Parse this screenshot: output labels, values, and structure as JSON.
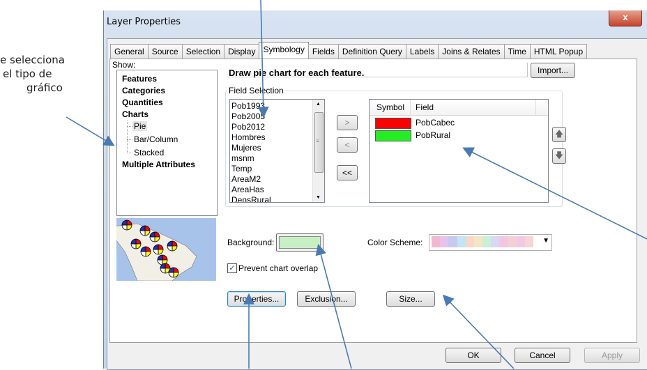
{
  "window": {
    "title": "Layer Properties",
    "close_glyph": "x"
  },
  "tabs": [
    "General",
    "Source",
    "Selection",
    "Display",
    "Symbology",
    "Fields",
    "Definition Query",
    "Labels",
    "Joins & Relates",
    "Time",
    "HTML Popup"
  ],
  "show": {
    "label": "Show:",
    "features": "Features",
    "categories": "Categories",
    "quantities": "Quantities",
    "charts": "Charts",
    "charts_children": [
      "Pie",
      "Bar/Column",
      "Stacked"
    ],
    "multiple": "Multiple Attributes"
  },
  "description": "Draw pie chart for each feature.",
  "import_button": "Import...",
  "field_selection": {
    "label": "Field Selection",
    "available": [
      "Pob1993",
      "Pob2005",
      "Pob2012",
      "Hombres",
      "Mujeres",
      "msnm",
      "Temp",
      "AreaM2",
      "AreaHas",
      "DensRural"
    ],
    "btn_add": ">",
    "btn_remove": "<",
    "btn_remove_all": "<<",
    "col_symbol": "Symbol",
    "col_field": "Field",
    "selected": [
      {
        "color": "#ff0000",
        "field": "PobCabec"
      },
      {
        "color": "#22ee22",
        "field": "PobRural"
      }
    ]
  },
  "background": {
    "label": "Background:",
    "color": "#c6f0c4"
  },
  "color_scheme": {
    "label": "Color Scheme:",
    "swatches": [
      "#f4b8cc",
      "#e7c2ef",
      "#c8c9f3",
      "#bfe6f2",
      "#f8d7c9",
      "#f3e6c2",
      "#c9efd6",
      "#d8d8f4",
      "#f1c7df",
      "#f6cfd6",
      "#eecbe3",
      "#f9d3d8"
    ]
  },
  "prevent_overlap": {
    "label": "Prevent chart overlap",
    "checked": true
  },
  "properties_button": "Properties...",
  "exclusion_button": "Exclusion...",
  "size_button": "Size...",
  "footer": {
    "ok": "OK",
    "cancel": "Cancel",
    "apply": "Apply"
  },
  "annotation": {
    "line1": "e selecciona",
    "line2": "el tipo de",
    "line3": "gráfico"
  },
  "icons": {
    "up": "arrow-up-icon",
    "down": "arrow-down-icon",
    "dropdown": "chevron-down-icon"
  }
}
